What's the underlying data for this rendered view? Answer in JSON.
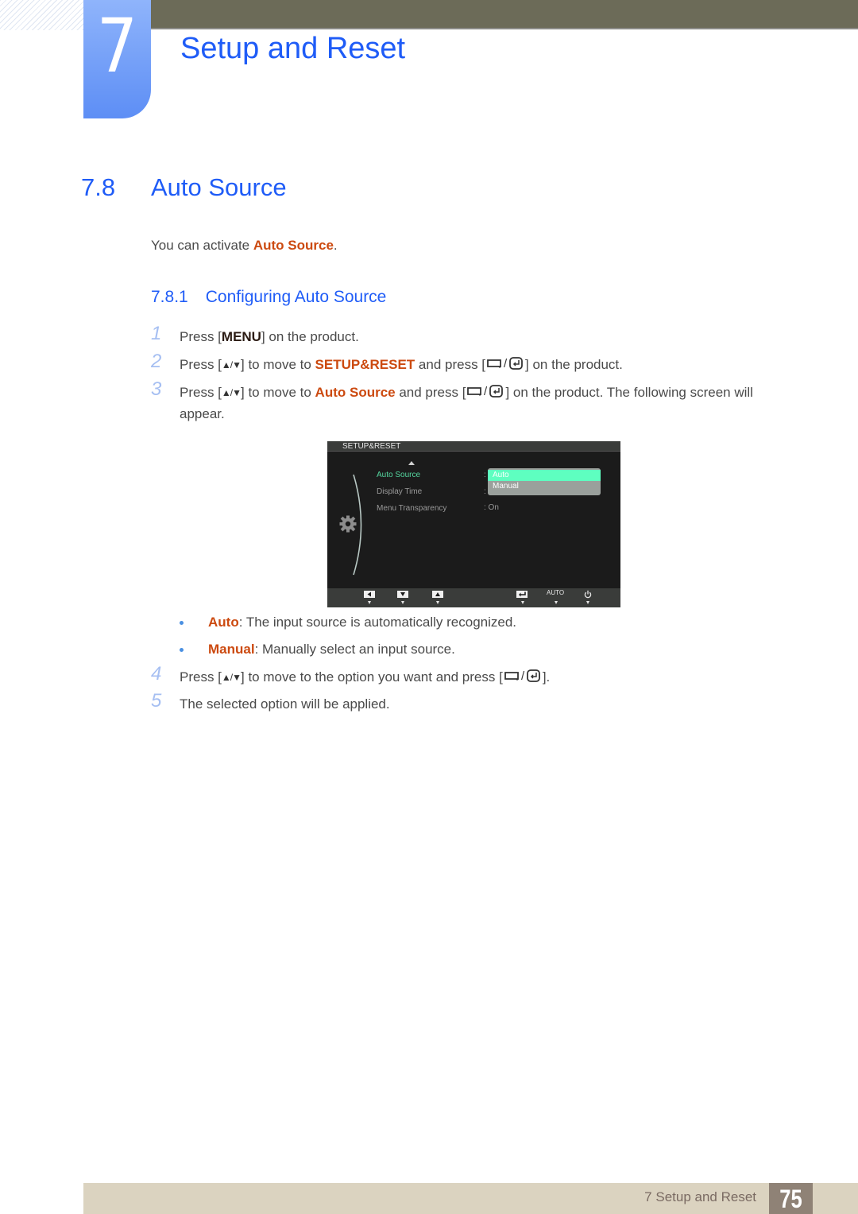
{
  "header": {
    "chapter_number": "7",
    "chapter_title": "Setup and Reset"
  },
  "section": {
    "number": "7.8",
    "title": "Auto Source",
    "intro_prefix": "You can activate ",
    "intro_highlight": "Auto Source",
    "intro_suffix": "."
  },
  "subsection": {
    "number": "7.8.1",
    "title": "Configuring Auto Source"
  },
  "steps": [
    {
      "number": "1",
      "parts": [
        "Press [",
        "MENU",
        "] on the product."
      ]
    },
    {
      "number": "2",
      "parts": [
        "Press [",
        "▲/▼",
        "] to move to ",
        "SETUP&RESET",
        " and press [",
        "] on the product."
      ]
    },
    {
      "number": "3",
      "parts": [
        "Press [",
        "▲/▼",
        "] to move to ",
        "Auto Source",
        " and press [",
        "] on the product. The following screen will"
      ],
      "continuation": "appear."
    },
    {
      "number": "4",
      "parts": [
        "Press [",
        "▲/▼",
        "] to move to the option you want and press [",
        "]."
      ]
    },
    {
      "number": "5",
      "parts": [
        "The selected option will be applied."
      ]
    }
  ],
  "osd": {
    "title": "SETUP&RESET",
    "items": [
      {
        "label": "Auto Source",
        "value": ":"
      },
      {
        "label": "Display Time",
        "value": ":"
      },
      {
        "label": "Menu Transparency",
        "value": ": On"
      }
    ],
    "dropdown_options": [
      "Auto",
      "Manual"
    ],
    "selected_option": "Auto",
    "footer_buttons": [
      "left-arrow",
      "down-arrow",
      "up-arrow",
      "enter",
      "AUTO",
      "power"
    ],
    "auto_label": "AUTO"
  },
  "bullets": [
    {
      "term": "Auto",
      "desc": ": The input source is automatically recognized."
    },
    {
      "term": "Manual",
      "desc": ": Manually select an input source."
    }
  ],
  "footer": {
    "chapter_label": "7 Setup and Reset",
    "page_number": "75"
  },
  "colors": {
    "heading_blue": "#1f5cf7",
    "highlight_orange": "#cc4a10",
    "osd_active_green": "#55d8a0",
    "osd_selected_bg": "#5effc0"
  }
}
